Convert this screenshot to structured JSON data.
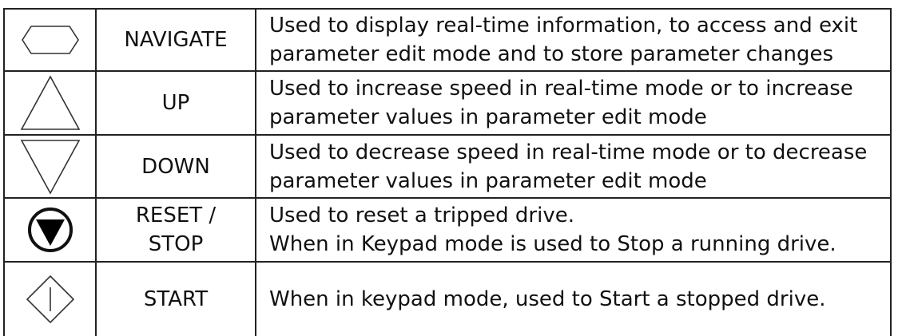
{
  "rows": [
    {
      "icon": "hexagon-navigate-icon",
      "name": [
        "NAVIGATE"
      ],
      "description": [
        "Used to display real-time information, to access and exit",
        "parameter edit mode and to store parameter changes"
      ]
    },
    {
      "icon": "triangle-up-icon",
      "name": [
        "UP"
      ],
      "description": [
        "Used to increase speed in real-time mode or to increase",
        "parameter values in parameter edit mode"
      ]
    },
    {
      "icon": "triangle-down-icon",
      "name": [
        "DOWN"
      ],
      "description": [
        "Used to decrease speed in real-time mode or to decrease",
        "parameter values in parameter edit mode"
      ]
    },
    {
      "icon": "circle-filled-down-triangle-icon",
      "name": [
        "RESET /",
        "STOP"
      ],
      "description": [
        "Used to reset a tripped drive.",
        "When in Keypad mode is used to Stop a running drive."
      ]
    },
    {
      "icon": "diamond-start-icon",
      "name": [
        "START"
      ],
      "description": [
        "When in keypad mode, used to Start a stopped drive."
      ]
    }
  ],
  "colors": {
    "line": "#222222",
    "text": "#111111",
    "background": "#ffffff"
  }
}
